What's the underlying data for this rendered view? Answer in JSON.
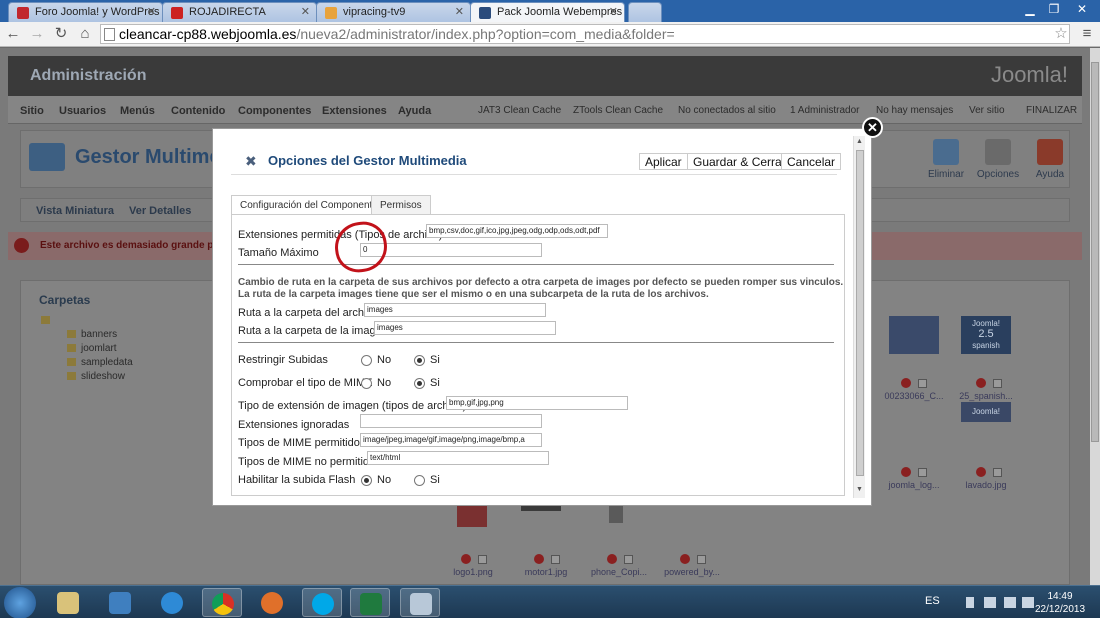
{
  "browser": {
    "tabs": [
      {
        "label": "Foro Joomla! y WordPres",
        "favicon_color": "#c1272d"
      },
      {
        "label": "ROJADIRECTA",
        "favicon_color": "#cc2222"
      },
      {
        "label": "vipracing-tv9",
        "favicon_color": "#e8a33c"
      },
      {
        "label": "Pack Joomla Webempres",
        "favicon_color": "#2a4b7c"
      }
    ],
    "url_domain": "cleancar-cp88.webjoomla.es",
    "url_path": "/nueva2/administrator/index.php?option=com_media&folder=",
    "min_icon": "minimize-icon",
    "max_icon": "maximize-icon",
    "close_icon": "close-icon"
  },
  "admin": {
    "header_title": "Administración",
    "logo_text": "Joomla!",
    "menu": [
      "Sitio",
      "Usuarios",
      "Menús",
      "Contenido",
      "Componentes",
      "Extensiones",
      "Ayuda"
    ],
    "status": [
      "JAT3 Clean Cache",
      "ZTools Clean Cache",
      "No conectados al sitio",
      "1 Administrador",
      "No hay mensajes",
      "Ver sitio",
      "FINALIZAR"
    ],
    "page_title": "Gestor Multimedi",
    "toolbar": [
      "Eliminar",
      "Opciones",
      "Ayuda"
    ],
    "subnav": [
      "Vista Miniatura",
      "Ver Detalles"
    ],
    "error": "Este archivo es demasiado grande para",
    "folders_title": "Carpetas",
    "folders": [
      "banners",
      "joomlart",
      "sampledata",
      "slideshow"
    ],
    "thumb_captions": [
      "00233066_C...",
      "25_spanish...",
      "joomla_log...",
      "lavado.jpg",
      "logo1.png",
      "motor1.jpg",
      "phone_Copi...",
      "powered_by..."
    ],
    "joomla25_badge_line1": "Joomla!",
    "joomla25_badge_line2": "2.5",
    "joomla25_badge_line3": "spanish",
    "joomla_thumb_label": "Joomla!"
  },
  "modal": {
    "title": "Opciones del Gestor Multimedia",
    "buttons": {
      "apply": "Aplicar",
      "save_close": "Guardar & Cerrar",
      "cancel": "Cancelar"
    },
    "tabs": [
      "Configuración del Componente",
      "Permisos"
    ],
    "fields": {
      "ext_label": "Extensiones permitidas (Tipos de archivo)",
      "ext_value": "bmp,csv,doc,gif,ico,jpg,jpeg,odg,odp,ods,odt,pdf",
      "max_label": "Tamaño Máximo",
      "max_value": "0",
      "note1": "Cambio de ruta en la carpeta de sus archivos por defecto a otra carpeta de images por defecto se pueden romper sus vinculos.",
      "note2": "La ruta de la carpeta images tiene que ser el mismo o en una subcarpeta de la ruta de los archivos.",
      "file_path_label": "Ruta a la carpeta del archivo",
      "file_path_value": "images",
      "image_path_label": "Ruta a la carpeta de la imagen",
      "image_path_value": "images",
      "restrict_label": "Restringir Subidas",
      "check_mime_label": "Comprobar el tipo de MIME",
      "image_ext_label": "Tipo de extensión de imagen (tipos de archivo)",
      "image_ext_value": "bmp,gif,jpg,png",
      "ignored_label": "Extensiones ignoradas",
      "ignored_value": "",
      "mime_allowed_label": "Tipos de MIME permitidos",
      "mime_allowed_value": "image/jpeg,image/gif,image/png,image/bmp,a",
      "mime_denied_label": "Tipos de MIME no permitidos",
      "mime_denied_value": "text/html",
      "flash_label": "Habilitar la subida Flash",
      "no": "No",
      "yes": "Si"
    },
    "radios": {
      "restrict": "Si",
      "check_mime": "Si",
      "flash": "No"
    }
  },
  "taskbar": {
    "apps": [
      "windows-explorer",
      "media-player",
      "internet-explorer",
      "chrome",
      "firefox",
      "skype",
      "excel",
      "other-app"
    ],
    "language": "ES",
    "time": "14:49",
    "date": "22/12/2013"
  }
}
